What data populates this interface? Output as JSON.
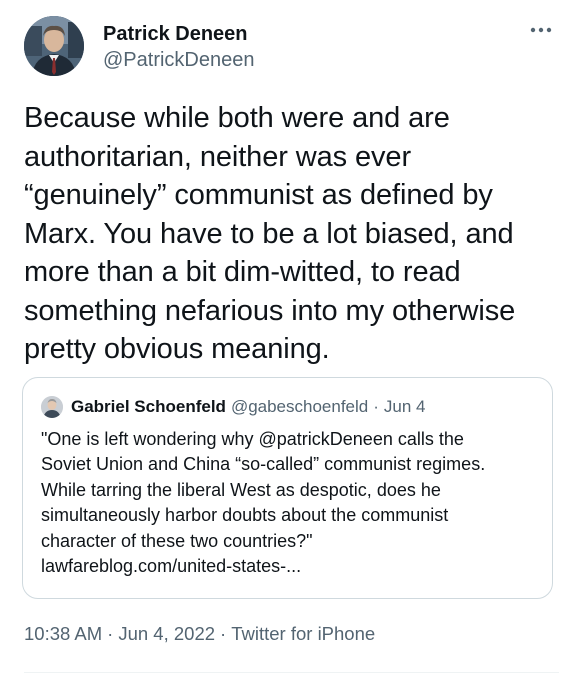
{
  "author": {
    "display_name": "Patrick Deneen",
    "handle": "@PatrickDeneen"
  },
  "tweet": {
    "text": "Because while both were and are\nauthoritarian, neither was ever\n“genuinely” communist as defined by\nMarx. You have to be a lot biased, and\nmore than a bit dim-witted, to read\nsomething nefarious into my otherwise\npretty obvious meaning."
  },
  "quoted_tweet": {
    "display_name": "Gabriel Schoenfeld",
    "handle": "@gabeschoenfeld",
    "separator": "·",
    "date": "Jun 4",
    "text": "\"One is left wondering why @patrickDeneen calls the\nSoviet Union and China “so-called” communist regimes.\nWhile tarring the liberal West as despotic, does he\nsimultaneously harbor doubts about the communist\ncharacter of these two countries?\"",
    "link": "lawfareblog.com/united-states-..."
  },
  "meta": {
    "time": "10:38 AM",
    "separator": "·",
    "date": "Jun 4, 2022",
    "source": "Twitter for iPhone"
  },
  "icons": {
    "more": "more-horizontal-icon"
  },
  "colors": {
    "text": "#0f1419",
    "secondary": "#536471",
    "border": "#cfd9de"
  }
}
